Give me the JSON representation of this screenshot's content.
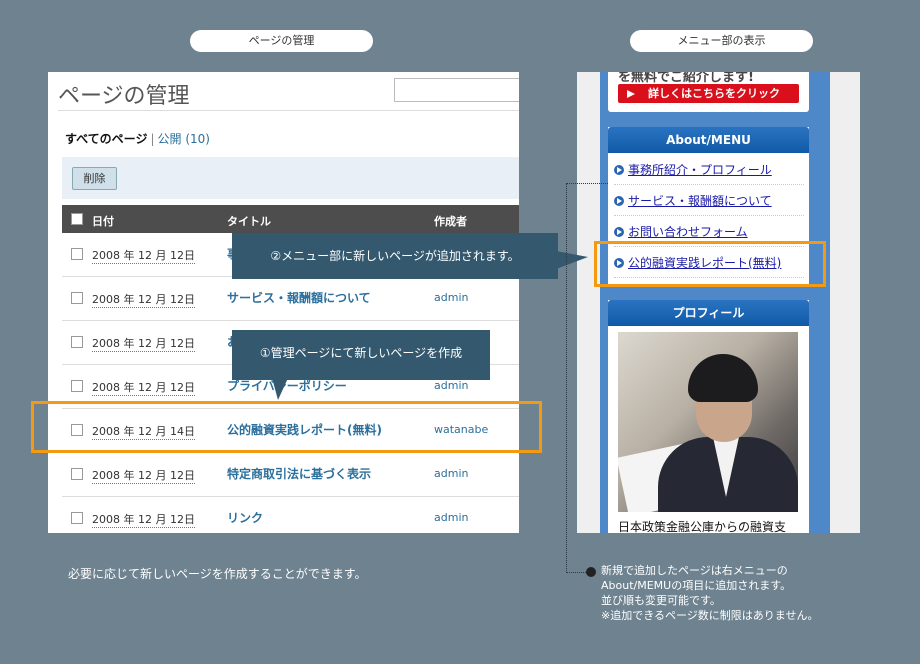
{
  "pills": {
    "left": "ページの管理",
    "right": "メニュー部の表示"
  },
  "admin": {
    "title": "ページの管理",
    "filters": {
      "all": "すべてのページ",
      "separator": "|",
      "published": "公開 (10)"
    },
    "delete_button": "削除",
    "columns": [
      "日付",
      "タイトル",
      "作成者"
    ],
    "rows": [
      {
        "date": "2008 年 12 月 12日",
        "title": "事",
        "author": ""
      },
      {
        "date": "2008 年 12 月 12日",
        "title": "サービス・報酬額について",
        "author": "admin"
      },
      {
        "date": "2008 年 12 月 12日",
        "title": "お",
        "author": ""
      },
      {
        "date": "2008 年 12 月 12日",
        "title": "プライバシーポリシー",
        "author": "admin"
      },
      {
        "date": "2008 年 12 月 14日",
        "title": "公的融資実践レポート(無料)",
        "author": "watanabe"
      },
      {
        "date": "2008 年 12 月 12日",
        "title": "特定商取引法に基づく表示",
        "author": "admin"
      },
      {
        "date": "2008 年 12 月 12日",
        "title": "リンク",
        "author": "admin"
      }
    ]
  },
  "menu": {
    "top_text": "を無料でご紹介します!",
    "red_button": "詳しくはこちらをクリック",
    "about_header": "About/MENU",
    "about_items": [
      "事務所紹介・プロフィール",
      "サービス・報酬額について",
      "お問い合わせフォーム",
      "公的融資実践レポート(無料)"
    ],
    "profile_header": "プロフィール",
    "profile_caption": "日本政策金融公庫からの融資支"
  },
  "callouts": {
    "menu_added": "②メニュー部に新しいページが追加されます。",
    "create_page": "①管理ページにて新しいページを作成"
  },
  "captions": {
    "left": "必要に応じて新しいページを作成することができます。",
    "right": [
      "新規で追加したページは右メニューの",
      "About/MEMUの項目に追加されます。",
      "並び順も変更可能です。",
      "※追加できるページ数に制限はありません。"
    ]
  },
  "colors": {
    "background": "#6e828f",
    "highlight": "#f39a12",
    "callout": "#34596e",
    "menu_blue": "#4e88c8",
    "link": "#2b6f9c"
  }
}
